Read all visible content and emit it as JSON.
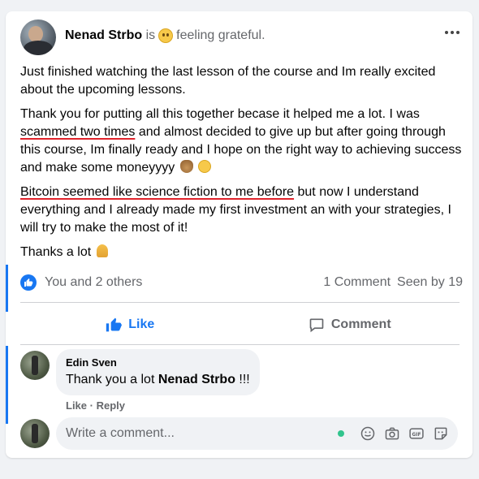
{
  "post": {
    "author": "Nenad Strbo",
    "is_word": "is",
    "feeling": "feeling grateful.",
    "paragraphs": {
      "p1": "Just finished watching the last lesson of the course and Im really excited about the upcoming lessons.",
      "p2_a": "Thank you for putting all this together becase it helped me a lot. I was ",
      "p2_underlined": "scammed two times",
      "p2_b": " and almost decided to give up but after going through this course, Im finally ready and I hope on the right way to achieving success and make some moneyyyy",
      "p3_underlined": "Bitcoin seemed like science fiction to me before",
      "p3_b": " but now I understand everything and I already made my first investment an with your strategies, I will try to make the most of it!",
      "p4": "Thanks a lot"
    },
    "emojis": [
      "feeling-grateful-emoji",
      "money-bag-emoji",
      "grinning-emoji",
      "folded-hands-emoji"
    ]
  },
  "stats": {
    "reactions": "You and 2 others",
    "comments": "1 Comment",
    "seen": "Seen by 19"
  },
  "actions": {
    "like_label": "Like",
    "comment_label": "Comment"
  },
  "comment": {
    "author": "Edin Sven",
    "text_a": "Thank you a lot ",
    "text_mention": "Nenad Strbo",
    "text_b": " !!!",
    "like_label": "Like",
    "dot": " · ",
    "reply_label": "Reply"
  },
  "composer": {
    "placeholder": "Write a comment...",
    "tools": [
      "emoji-icon",
      "camera-icon",
      "gif-icon",
      "sticker-icon"
    ]
  },
  "colors": {
    "accent": "#1877f2",
    "underline": "#e0232b",
    "online": "#31c48d"
  }
}
